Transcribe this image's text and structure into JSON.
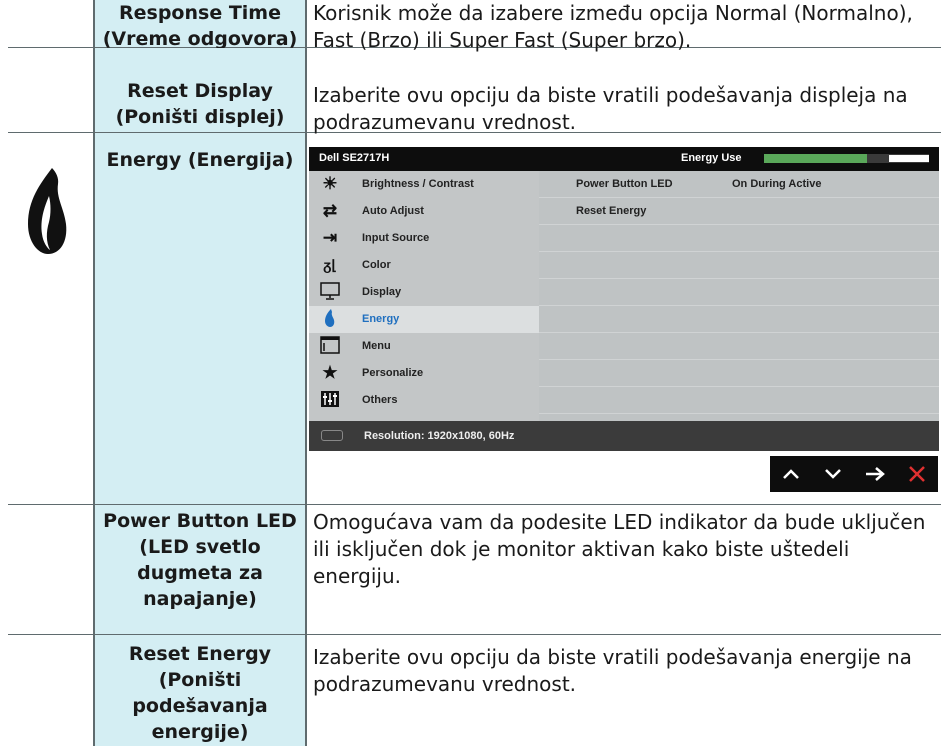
{
  "rows": [
    {
      "name": "Response Time (Vreme odgovora)",
      "desc": "Korisnik može da izabere između opcija Normal (Normalno), Fast (Brzo) ili Super Fast (Super brzo)."
    },
    {
      "name": "Reset Display (Poništi displej)",
      "desc": "Izaberite ovu opciju da biste vratili podešavanja displeja na podrazumevanu vrednost."
    },
    {
      "name": "Energy (Energija)",
      "desc": ""
    },
    {
      "name": "Power Button LED (LED svetlo dugmeta za napajanje)",
      "desc": "Omogućava vam da podesite LED indikator da bude uključen ili isključen dok je monitor aktivan kako biste uštedeli energiju."
    },
    {
      "name": "Reset Energy (Poništi podešavanja energije)",
      "desc": "Izaberite ovu opciju da biste vratili podešavanja energije na podrazumevanu vrednost."
    }
  ],
  "osd": {
    "title": "Dell SE2717H",
    "energy_use_label": "Energy Use",
    "energy_use_level": 0.82,
    "menu": [
      {
        "label": "Brightness / Contrast",
        "icon": "brightness-icon"
      },
      {
        "label": "Auto Adjust",
        "icon": "auto-adjust-icon"
      },
      {
        "label": "Input Source",
        "icon": "input-source-icon"
      },
      {
        "label": "Color",
        "icon": "color-icon"
      },
      {
        "label": "Display",
        "icon": "display-icon"
      },
      {
        "label": "Energy",
        "icon": "energy-icon",
        "selected": true
      },
      {
        "label": "Menu",
        "icon": "menu-icon"
      },
      {
        "label": "Personalize",
        "icon": "personalize-icon"
      },
      {
        "label": "Others",
        "icon": "others-icon"
      }
    ],
    "submenu": [
      {
        "label": "Power Button LED",
        "value": "On During Active"
      },
      {
        "label": "Reset Energy",
        "value": ""
      }
    ],
    "status": "Resolution: 1920x1080, 60Hz"
  },
  "nav_buttons": [
    "up-arrow-icon",
    "down-arrow-icon",
    "right-arrow-icon",
    "close-icon"
  ],
  "colors": {
    "header_bg": "#d4eef3",
    "selected_menu_text": "#1f6fbf",
    "close_red": "#e03030",
    "energy_bar": "#5aa85a"
  }
}
